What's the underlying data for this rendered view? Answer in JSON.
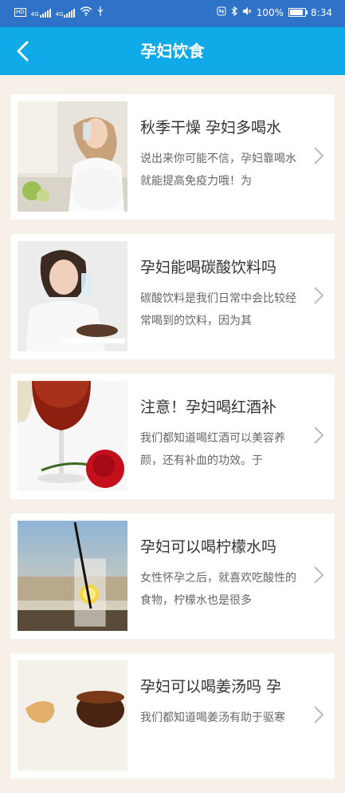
{
  "status_bar": {
    "left_labels": [
      "HD",
      "4G",
      "4G"
    ],
    "battery": "100%",
    "time": "8:34"
  },
  "header": {
    "title": "孕妇饮食"
  },
  "articles": [
    {
      "title": "秋季干燥 孕妇多喝水",
      "summary": "说出来你可能不信，孕妇靠喝水就能提高免疫力哦！为",
      "thumb": "pregnant-woman-drinking-water-image"
    },
    {
      "title": "孕妇能喝碳酸饮料吗",
      "summary": "碳酸饮料是我们日常中会比较经常喝到的饮料，因为其",
      "thumb": "woman-with-glass-image"
    },
    {
      "title": "注意！孕妇喝红酒补",
      "summary": "我们都知道喝红酒可以美容养颜，还有补血的功效。于",
      "thumb": "red-wine-and-rose-image"
    },
    {
      "title": "孕妇可以喝柠檬水吗",
      "summary": "女性怀孕之后，就喜欢吃酸性的食物，柠檬水也是很多",
      "thumb": "lemon-water-glass-image"
    },
    {
      "title": "孕妇可以喝姜汤吗 孕",
      "summary": "我们都知道喝姜汤有助于驱寒",
      "thumb": "ginger-tea-image"
    }
  ],
  "colors": {
    "status": "#2e73c8",
    "header": "#11aae9",
    "background": "#f6f0e8"
  }
}
